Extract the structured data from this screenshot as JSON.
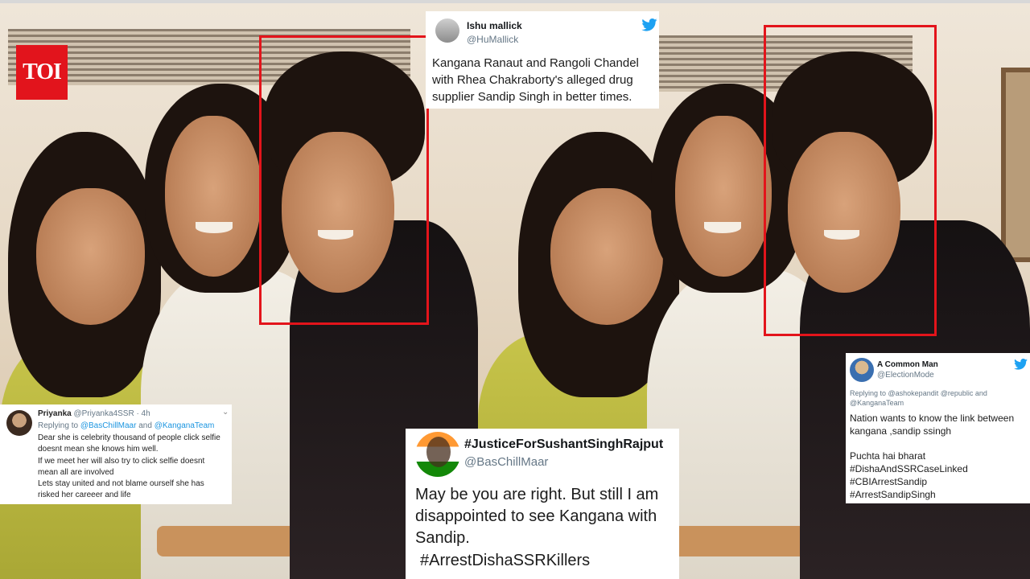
{
  "brand": {
    "logo_text": "TOI",
    "logo_color": "#e2141c"
  },
  "highlight_color": "#e3141b",
  "tweets": {
    "t1": {
      "name": "Ishu mallick",
      "handle": "@HuMallick",
      "icon": "twitter-bird-icon",
      "lines": [
        "Kangana Ranaut and Rangoli Chandel",
        "with Rhea Chakraborty's alleged drug",
        "supplier Sandip Singh in better times."
      ]
    },
    "t2": {
      "name": "Priyanka",
      "handle": "@Priyanka4SSR",
      "time": "· 4h",
      "reply_prefix": "Replying to",
      "reply_to_1": "@BasChillMaar",
      "reply_and": "and",
      "reply_to_2": "@KanganaTeam",
      "lines": [
        "Dear she is celebrity thousand of people click selfie",
        "doesnt mean she knows him well.",
        "If we meet her will also try to click  selfie doesnt",
        "mean all are involved",
        "Lets stay united and not blame ourself she has",
        "risked her careeer and life"
      ]
    },
    "t3": {
      "name": "#JusticeForSushantSinghRajput",
      "handle": "@BasChillMaar",
      "lines": [
        "May be you are right. But still I am",
        "disappointed to see Kangana with",
        "Sandip."
      ],
      "hashtag": "#ArrestDishaSSRKillers"
    },
    "t4": {
      "name": "A Common Man",
      "handle": "@ElectionMode",
      "icon": "twitter-bird-icon",
      "reply_line_1": "Replying to @ashokepandit @republic and",
      "reply_line_2": "@KanganaTeam",
      "lines": [
        "Nation wants to know the link between",
        "kangana ,sandip ssingh"
      ],
      "extra": "Puchta hai bharat",
      "hashtags": [
        "#DishaAndSSRCaseLinked",
        "#CBIArrestSandip",
        "#ArrestSandipSingh"
      ]
    }
  }
}
